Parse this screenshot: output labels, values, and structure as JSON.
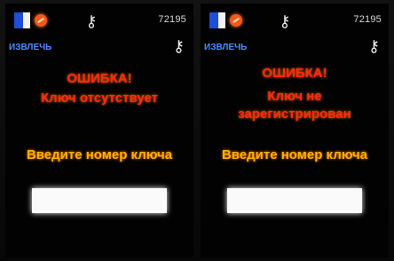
{
  "screens": [
    {
      "counter": "72195",
      "extract_label": "ИЗВЛЕЧЬ",
      "error_title": "ОШИБКА!",
      "error_lines": [
        "Ключ отсутствует"
      ],
      "prompt": "Введите номер ключа",
      "input_value": "",
      "icons": [
        "door-icon",
        "warning-circle-icon",
        "key-icon",
        "key-icon"
      ]
    },
    {
      "counter": "72195",
      "extract_label": "ИЗВЛЕЧЬ",
      "error_title": "ОШИБКА!",
      "error_lines": [
        "Ключ не",
        "зарегистрирован"
      ],
      "prompt": "Введите номер ключа",
      "input_value": "",
      "icons": [
        "door-icon",
        "warning-circle-icon",
        "key-icon",
        "key-icon"
      ]
    }
  ],
  "colors": {
    "error": "#ff2a12",
    "prompt": "#ffb000",
    "extract": "#4d8cff"
  }
}
